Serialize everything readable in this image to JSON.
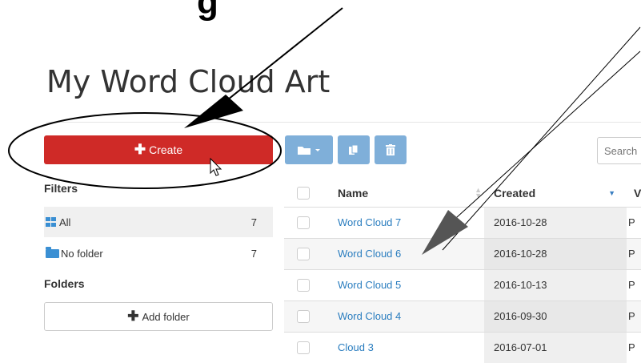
{
  "banner": {
    "text": "g"
  },
  "page": {
    "title": "My Word Cloud Art"
  },
  "sidebar": {
    "create_label": "Create",
    "filters_heading": "Filters",
    "filters": [
      {
        "label": "All",
        "count": "7",
        "icon": "grid-icon"
      },
      {
        "label": "No folder",
        "count": "7",
        "icon": "folder-icon"
      }
    ],
    "folders_heading": "Folders",
    "add_folder_label": "Add folder"
  },
  "toolbar": {
    "search_placeholder": "Search"
  },
  "table": {
    "columns": {
      "name": "Name",
      "created": "Created",
      "visibility_fragment": "V"
    },
    "rows": [
      {
        "name": "Word Cloud 7",
        "created": "2016-10-28",
        "extra": "P"
      },
      {
        "name": "Word Cloud 6",
        "created": "2016-10-28",
        "extra": "P"
      },
      {
        "name": "Word Cloud 5",
        "created": "2016-10-13",
        "extra": "P"
      },
      {
        "name": "Word Cloud 4",
        "created": "2016-09-30",
        "extra": "P"
      },
      {
        "name": "Cloud 3",
        "created": "2016-07-01",
        "extra": "P"
      }
    ]
  },
  "colors": {
    "create_button": "#cf2a27",
    "toolbar_button": "#7fafd9",
    "link": "#2a7dbf",
    "icon_blue": "#3a8fd3"
  }
}
